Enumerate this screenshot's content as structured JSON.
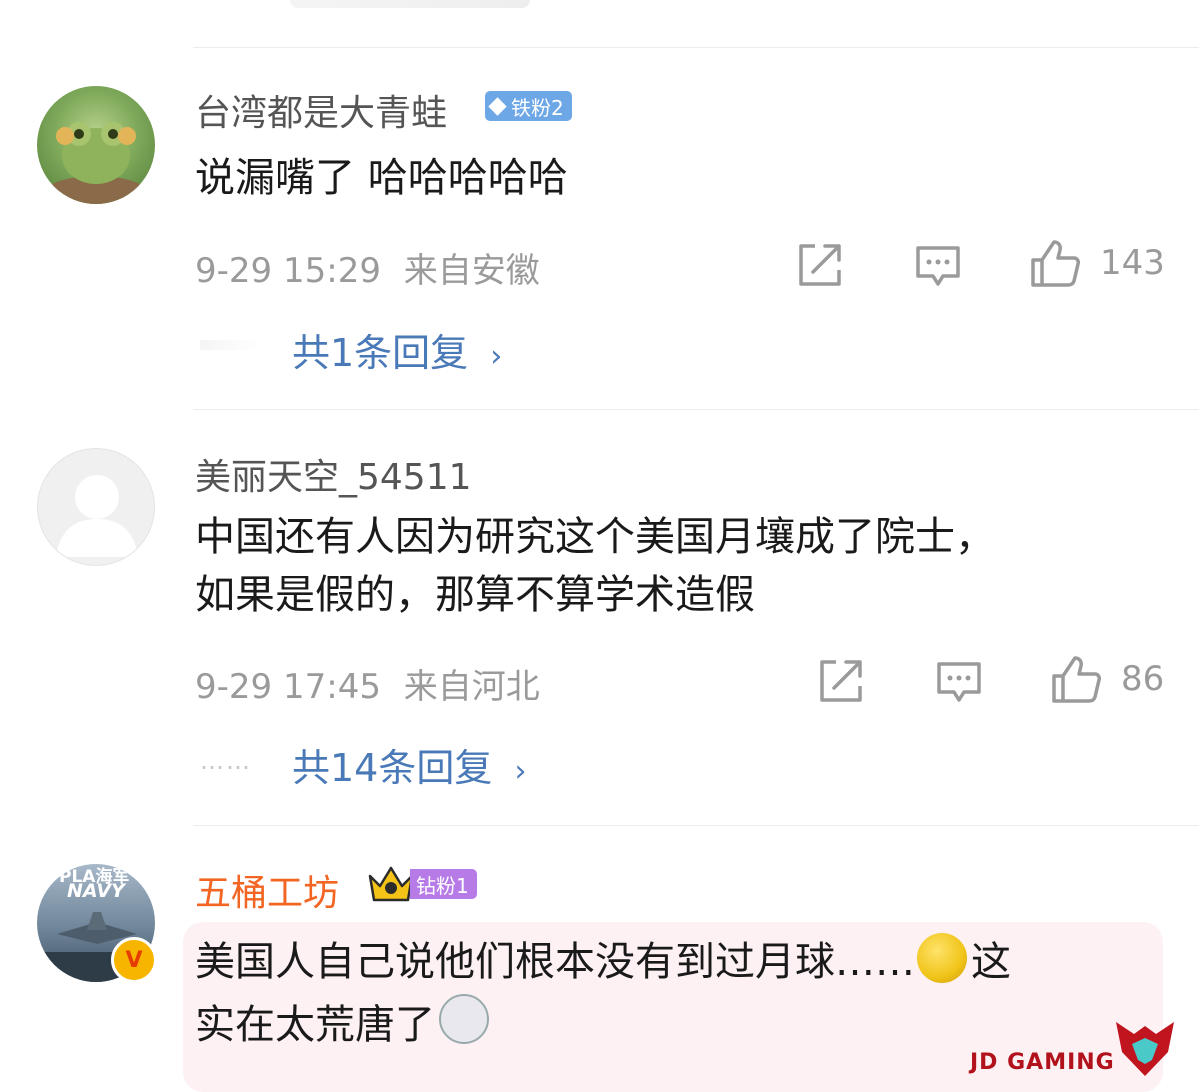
{
  "comments": [
    {
      "username": "台湾都是大青蛙",
      "badge": "铁粉2",
      "text": "说漏嘴了 哈哈哈哈哈",
      "time": "9-29 15:29",
      "location": "来自安徽",
      "likes": "143",
      "replies": "共1条回复"
    },
    {
      "username": "美丽天空_54511",
      "text_line1": "中国还有人因为研究这个美国月壤成了院士，",
      "text_line2": "如果是假的，那算不算学术造假",
      "time": "9-29 17:45",
      "location": "来自河北",
      "likes": "86",
      "replies": "共14条回复",
      "dots": "……"
    },
    {
      "username": "五桶工坊",
      "badge": "钻粉1",
      "avatar_text_line1": "PLA海军",
      "avatar_text_line2": "NAVY",
      "verified_mark": "V",
      "text_line1": "美国人自己说他们根本没有到过月球……",
      "text_line1_end": "这",
      "text_line2": "实在太荒唐了"
    }
  ],
  "watermark": "JD GAMING",
  "colors": {
    "reply_link": "#4a79b8",
    "username_vip": "#f26522",
    "badge_iron": "#6da7e6",
    "badge_diamond": "#b77be8"
  },
  "icons": [
    "repost-icon",
    "comment-icon",
    "like-icon",
    "chevron-right-icon",
    "diamond-icon",
    "crown-icon",
    "moon-emoji-icon",
    "doge-emoji-icon"
  ]
}
